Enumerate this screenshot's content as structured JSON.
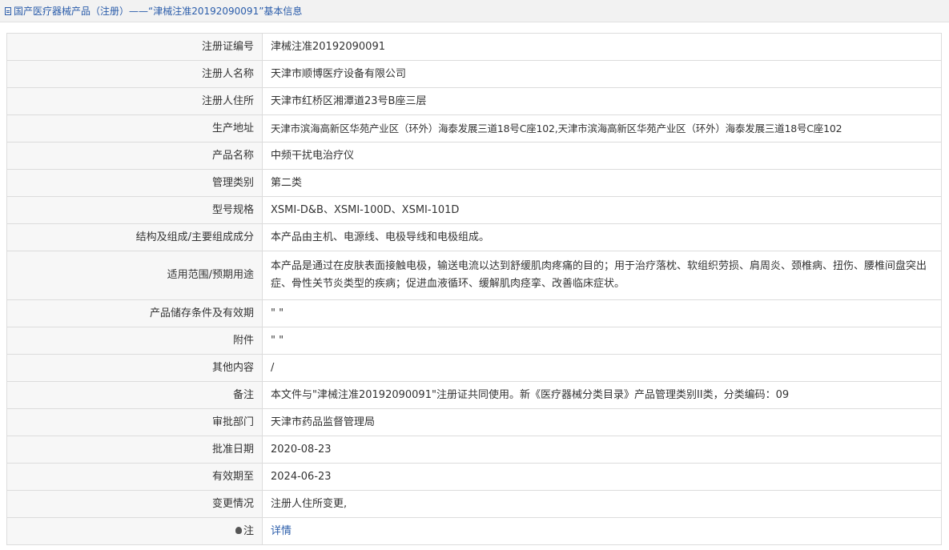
{
  "breadcrumb": {
    "icon": "document-icon",
    "text": "国产医疗器械产品（注册）——“津械注准20192090091”基本信息"
  },
  "rows": [
    {
      "label": "注册证编号",
      "value": "津械注准20192090091"
    },
    {
      "label": "注册人名称",
      "value": "天津市顺博医疗设备有限公司"
    },
    {
      "label": "注册人住所",
      "value": "天津市红桥区湘潭道23号B座三层"
    },
    {
      "label": "生产地址",
      "value": "天津市滨海高新区华苑产业区（环外）海泰发展三道18号C座102,天津市滨海高新区华苑产业区（环外）海泰发展三道18号C座102"
    },
    {
      "label": "产品名称",
      "value": "中频干扰电治疗仪"
    },
    {
      "label": "管理类别",
      "value": "第二类"
    },
    {
      "label": "型号规格",
      "value": "XSMI-D&B、XSMI-100D、XSMI-101D"
    },
    {
      "label": "结构及组成/主要组成成分",
      "value": "本产品由主机、电源线、电极导线和电极组成。"
    },
    {
      "label": "适用范围/预期用途",
      "value": "本产品是通过在皮肤表面接触电极，输送电流以达到舒缓肌肉疼痛的目的；用于治疗落枕、软组织劳损、肩周炎、颈椎病、扭伤、腰椎间盘突出症、骨性关节炎类型的疾病；促进血液循环、缓解肌肉痉挛、改善临床症状。"
    },
    {
      "label": "产品储存条件及有效期",
      "value": "\" \""
    },
    {
      "label": "附件",
      "value": "\" \""
    },
    {
      "label": "其他内容",
      "value": "/"
    },
    {
      "label": "备注",
      "value": "本文件与\"津械注准20192090091\"注册证共同使用。新《医疗器械分类目录》产品管理类别II类，分类编码：09"
    },
    {
      "label": "审批部门",
      "value": "天津市药品监督管理局"
    },
    {
      "label": "批准日期",
      "value": "2020-08-23"
    },
    {
      "label": "有效期至",
      "value": "2024-06-23"
    },
    {
      "label": "变更情况",
      "value": "注册人住所变更,"
    }
  ],
  "note_row": {
    "icon": "lightbulb-icon",
    "label": "注",
    "link": "详情"
  }
}
